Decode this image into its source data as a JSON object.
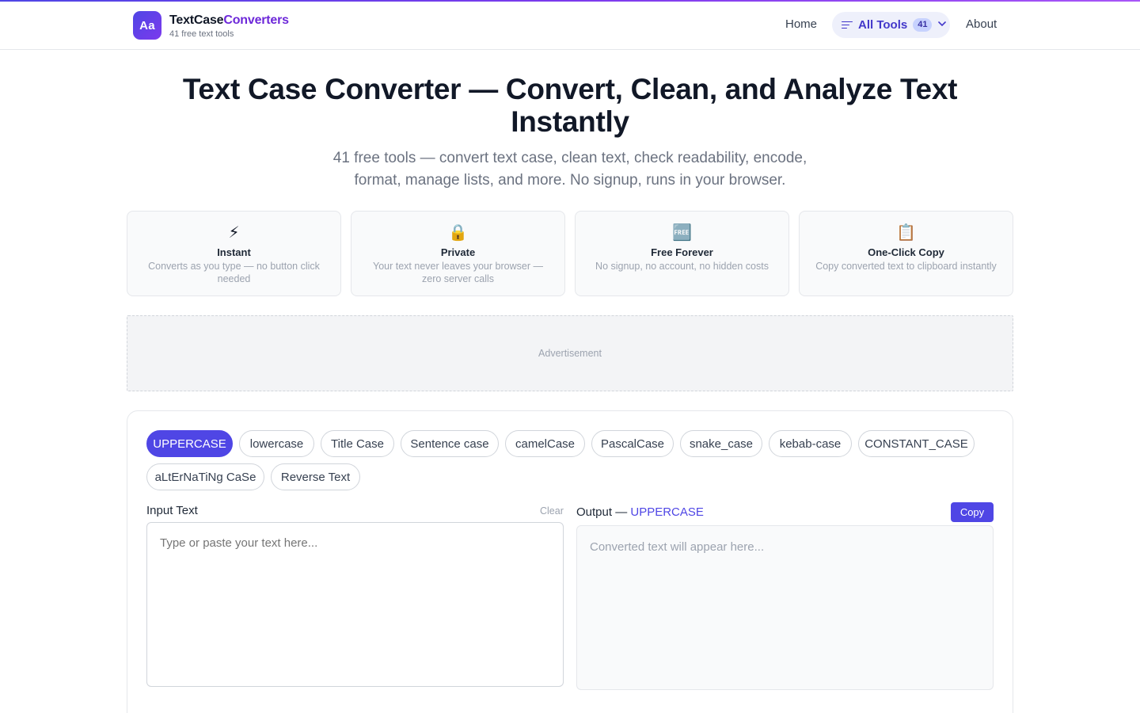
{
  "header": {
    "logo_text": "Aa",
    "brand_main": "TextCase",
    "brand_accent": "Converters",
    "brand_sub": "41 free text tools",
    "nav": {
      "home": "Home",
      "all_tools": "All Tools",
      "all_tools_count": "41",
      "about": "About"
    }
  },
  "hero": {
    "title": "Text Case Converter — Convert, Clean, and Analyze Text Instantly",
    "subtitle": "41 free tools — convert text case, clean text, check readability, encode, format, manage lists, and more. No signup, runs in your browser."
  },
  "features": [
    {
      "icon": "⚡",
      "icon_name": "lightning-icon",
      "title": "Instant",
      "desc": "Converts as you type — no button click needed"
    },
    {
      "icon": "🔒",
      "icon_name": "lock-icon",
      "title": "Private",
      "desc": "Your text never leaves your browser — zero server calls"
    },
    {
      "icon": "🆓",
      "icon_name": "free-icon",
      "title": "Free Forever",
      "desc": "No signup, no account, no hidden costs"
    },
    {
      "icon": "📋",
      "icon_name": "clipboard-icon",
      "title": "One-Click Copy",
      "desc": "Copy converted text to clipboard instantly"
    }
  ],
  "ad": {
    "label": "Advertisement"
  },
  "converter": {
    "modes": [
      "UPPERCASE",
      "lowercase",
      "Title Case",
      "Sentence case",
      "camelCase",
      "PascalCase",
      "snake_case",
      "kebab-case",
      "CONSTANT_CASE",
      "aLtErNaTiNg CaSe",
      "Reverse Text"
    ],
    "active_mode": "UPPERCASE",
    "input_label": "Input Text",
    "clear_label": "Clear",
    "input_placeholder": "Type or paste your text here...",
    "output_label_prefix": "Output —",
    "output_mode": "UPPERCASE",
    "copy_label": "Copy",
    "output_placeholder": "Converted text will appear here..."
  },
  "colors": {
    "accent": "#4f46e5",
    "brand_accent": "#6d28d9"
  }
}
